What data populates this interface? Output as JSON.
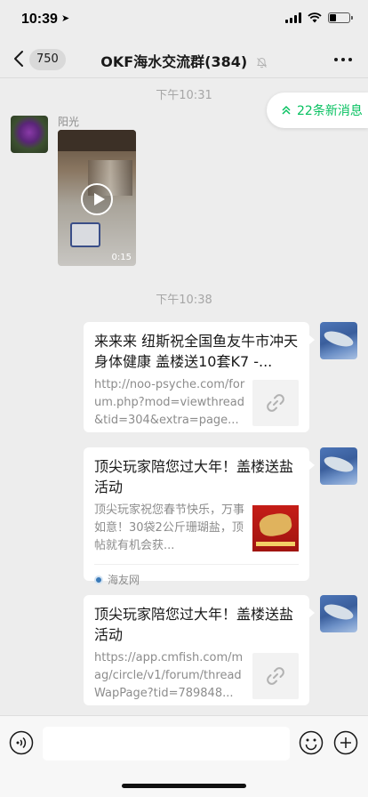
{
  "status": {
    "time": "10:39",
    "battery_level": 0.35
  },
  "nav": {
    "back_count": "750",
    "title": "OKF海水交流群(384)"
  },
  "messages": {
    "ts1": "下午10:31",
    "new_messages": "22条新消息",
    "sender_name": "阳光",
    "video_duration": "0:15",
    "ts2": "下午10:38",
    "card1": {
      "title": "来来来 纽斯祝全国鱼友牛市冲天 身体健康 盖楼送10套K7 -...",
      "desc": "http://noo-psyche.com/forum.php?mod=viewthread&tid=304&extra=page..."
    },
    "card2": {
      "title": "顶尖玩家陪您过大年！盖楼送盐活动",
      "desc": "顶尖玩家祝您春节快乐，万事如意！30袋2公斤珊瑚盐，顶帖就有机会获...",
      "source": "海友网"
    },
    "card3": {
      "title": "顶尖玩家陪您过大年！盖楼送盐活动",
      "desc": "https://app.cmfish.com/mag/circle/v1/forum/threadWapPage?tid=789848..."
    }
  },
  "input": {
    "placeholder": ""
  },
  "colors": {
    "accent": "#07c160",
    "background": "#ededed"
  }
}
